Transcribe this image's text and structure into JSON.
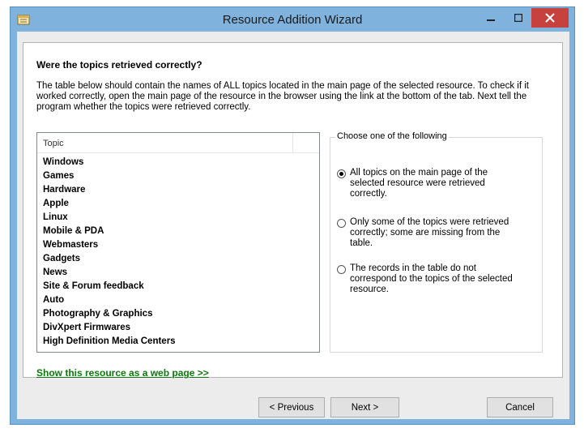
{
  "window": {
    "title": "Resource Addition Wizard",
    "icon": "wizard-app-icon"
  },
  "page": {
    "heading": "Were the topics retrieved correctly?",
    "description": "The table below should contain the names of ALL topics located in the main page of the selected resource. To check if it worked correctly, open the main page of the resource in the browser using the link at the bottom of the tab. Next tell the program whether the topics were retrieved correctly."
  },
  "topics": {
    "column_header": "Topic",
    "items": [
      "Windows",
      "Games",
      "Hardware",
      "Apple",
      "Linux",
      "Mobile & PDA",
      "Webmasters",
      "Gadgets",
      "News",
      "Site & Forum feedback",
      "Auto",
      "Photography & Graphics",
      "DivXpert Firmwares",
      "High Definition Media Centers"
    ]
  },
  "choices": {
    "label": "Choose one of the following",
    "options": [
      {
        "label": "All topics on the main page of the selected resource were retrieved correctly.",
        "selected": true
      },
      {
        "label": "Only some of the topics were retrieved correctly; some are missing from the table.",
        "selected": false
      },
      {
        "label": "The records in the table do not correspond to the topics of the selected resource.",
        "selected": false
      }
    ]
  },
  "link": {
    "text": "Show this resource as a web page >>"
  },
  "buttons": {
    "previous": "< Previous",
    "next": "Next >",
    "cancel": "Cancel"
  },
  "colors": {
    "frame": "#7fb3de",
    "close_button": "#c7413e",
    "link": "#0b7a0b"
  }
}
